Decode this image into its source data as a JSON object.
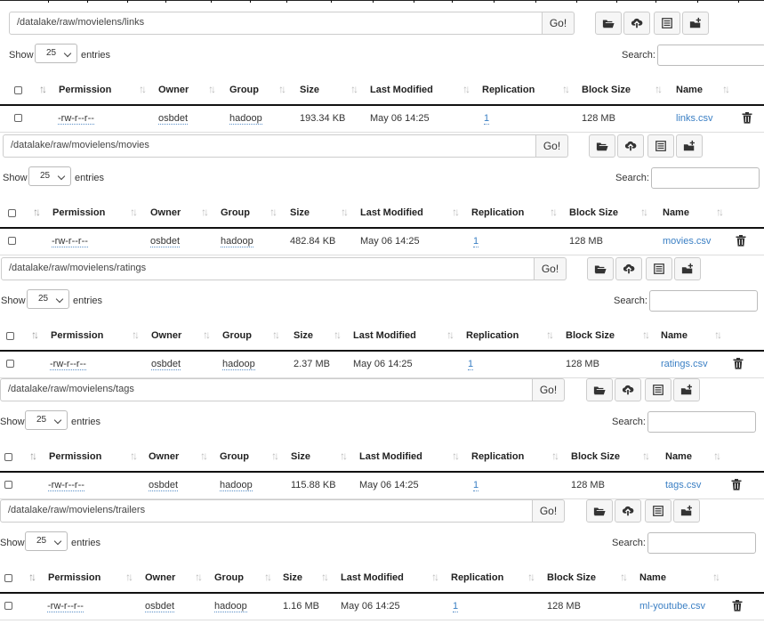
{
  "go_label": "Go!",
  "show_label": "Show",
  "entries_label": "entries",
  "page_length": "25",
  "search_label": "Search:",
  "columns": [
    "Permission",
    "Owner",
    "Group",
    "Size",
    "Last Modified",
    "Replication",
    "Block Size",
    "Name"
  ],
  "icons": [
    "folder-open-icon",
    "upload-cloud-icon",
    "list-icon",
    "add-folder-icon",
    "trash-icon",
    "sort-icon"
  ],
  "colors": {
    "link": "#3a7fc4",
    "header_rule": "#111111"
  },
  "sections": [
    {
      "path": "/datalake/raw/movielens/links",
      "file": {
        "permission": "-rw-r--r--",
        "owner": "osbdet",
        "group": "hadoop",
        "size": "193.34 KB",
        "modified": "May 06 14:25",
        "replication": "1",
        "block_size": "128 MB",
        "name": "links.csv"
      }
    },
    {
      "path": "/datalake/raw/movielens/movies",
      "file": {
        "permission": "-rw-r--r--",
        "owner": "osbdet",
        "group": "hadoop",
        "size": "482.84 KB",
        "modified": "May 06 14:25",
        "replication": "1",
        "block_size": "128 MB",
        "name": "movies.csv"
      }
    },
    {
      "path": "/datalake/raw/movielens/ratings",
      "file": {
        "permission": "-rw-r--r--",
        "owner": "osbdet",
        "group": "hadoop",
        "size": "2.37 MB",
        "modified": "May 06 14:25",
        "replication": "1",
        "block_size": "128 MB",
        "name": "ratings.csv"
      }
    },
    {
      "path": "/datalake/raw/movielens/tags",
      "file": {
        "permission": "-rw-r--r--",
        "owner": "osbdet",
        "group": "hadoop",
        "size": "115.88 KB",
        "modified": "May 06 14:25",
        "replication": "1",
        "block_size": "128 MB",
        "name": "tags.csv"
      }
    },
    {
      "path": "/datalake/raw/movielens/trailers",
      "file": {
        "permission": "-rw-r--r--",
        "owner": "osbdet",
        "group": "hadoop",
        "size": "1.16 MB",
        "modified": "May 06 14:25",
        "replication": "1",
        "block_size": "128 MB",
        "name": "ml-youtube.csv"
      }
    }
  ]
}
